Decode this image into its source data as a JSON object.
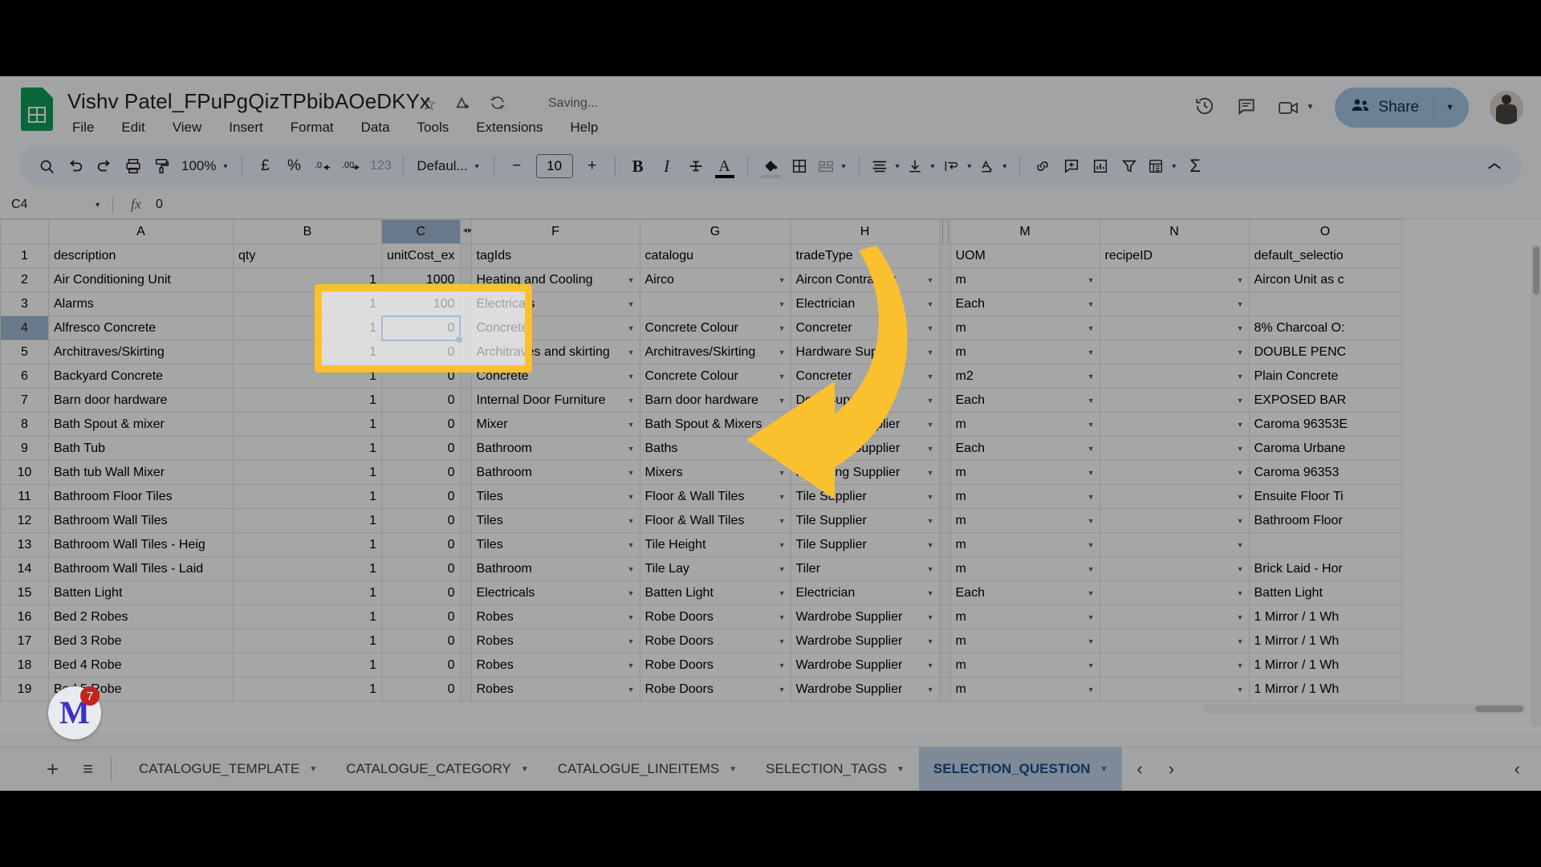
{
  "header": {
    "doc_title": "Vishv Patel_FPuPgQizTPbibAOeDKYx",
    "star_icon": "star-icon",
    "drive_icon": "move-to-drive-icon",
    "cloud_icon": "sync-icon",
    "save_status": "Saving...",
    "menus": [
      "File",
      "Edit",
      "View",
      "Insert",
      "Format",
      "Data",
      "Tools",
      "Extensions",
      "Help"
    ],
    "history_icon": "version-history-icon",
    "comment_icon": "comment-icon",
    "meet_icon": "meet-camera-icon",
    "share_label": "Share",
    "avatar": "user-avatar"
  },
  "toolbar": {
    "search": "🔍",
    "undo": "↺",
    "redo": "↻",
    "print": "print-icon",
    "paint": "paint-format-icon",
    "zoom": "100%",
    "currency": "£",
    "percent": "%",
    "dec_decrease": ".0",
    "dec_increase": ".00",
    "formats": "123",
    "font": "Defaul...",
    "font_size_minus": "−",
    "font_size": "10",
    "font_size_plus": "+",
    "bold": "B",
    "italic": "I",
    "strike": "S",
    "text_color": "A",
    "fill_color": "fill-color-icon",
    "borders": "borders-icon",
    "merge": "merge-cells-icon",
    "halign": "horizontal-align-icon",
    "valign": "vertical-align-icon",
    "wrap": "text-wrap-icon",
    "rotate": "text-rotation-icon",
    "link": "insert-link-icon",
    "comment_add": "insert-comment-icon",
    "chart": "insert-chart-icon",
    "filter": "filter-icon",
    "functions_calc": "pivot-icon",
    "sum": "Σ",
    "collapse": "collapse-toolbar-icon"
  },
  "formula_bar": {
    "cell_ref": "C4",
    "fx": "fx",
    "value": "0"
  },
  "grid": {
    "columns": [
      {
        "id": "A",
        "selected": false
      },
      {
        "id": "B",
        "selected": false
      },
      {
        "id": "C",
        "selected": true
      },
      {
        "id": "F",
        "selected": false
      },
      {
        "id": "G",
        "selected": false
      },
      {
        "id": "H",
        "selected": false
      },
      {
        "id": "M",
        "selected": false
      },
      {
        "id": "N",
        "selected": false
      },
      {
        "id": "O",
        "selected": false
      }
    ],
    "headers": [
      "description",
      "qty",
      "unitCost_ex",
      "tagIds",
      "catalogu",
      "tradeType",
      "UOM",
      "recipeID",
      "default_selectio"
    ],
    "selected_row": 4,
    "rows": [
      {
        "n": 1,
        "cells": [
          "description",
          "qty",
          "unitCost_ex",
          "tagIds",
          "catalogu",
          "tradeType",
          "UOM",
          "recipeID",
          "default_selectio"
        ],
        "is_header": true
      },
      {
        "n": 2,
        "cells": [
          "Air Conditioning Unit",
          "1",
          "1000",
          "Heating and Cooling",
          "Airco",
          "Aircon Contractor",
          "m",
          "",
          "Aircon Unit as c"
        ]
      },
      {
        "n": 3,
        "cells": [
          "Alarms",
          "1",
          "100",
          "Electricals",
          "",
          "Electrician",
          "Each",
          "",
          ""
        ]
      },
      {
        "n": 4,
        "cells": [
          "Alfresco Concrete",
          "1",
          "0",
          "Concrete",
          "Concrete Colour",
          "Concreter",
          "m",
          "",
          "8% Charcoal O:"
        ]
      },
      {
        "n": 5,
        "cells": [
          "Architraves/Skirting",
          "1",
          "0",
          "Architraves and skirting",
          "Architraves/Skirting",
          "Hardware Supplier",
          "m",
          "",
          "DOUBLE PENC"
        ]
      },
      {
        "n": 6,
        "cells": [
          "Backyard Concrete",
          "1",
          "0",
          "Concrete",
          "Concrete Colour",
          "Concreter",
          "m2",
          "",
          "Plain Concrete"
        ]
      },
      {
        "n": 7,
        "cells": [
          "Barn door hardware",
          "1",
          "0",
          "Internal Door Furniture",
          "Barn door hardware",
          "Door Supplier",
          "Each",
          "",
          "EXPOSED BAR"
        ]
      },
      {
        "n": 8,
        "cells": [
          "Bath Spout & mixer",
          "1",
          "0",
          "Mixer",
          "Bath Spout & Mixers",
          "Plumbing Supplier",
          "m",
          "",
          "Caroma 96353E"
        ]
      },
      {
        "n": 9,
        "cells": [
          "Bath Tub",
          "1",
          "0",
          "Bathroom",
          "Baths",
          "Plumbing Supplier",
          "Each",
          "",
          "Caroma Urbane"
        ]
      },
      {
        "n": 10,
        "cells": [
          "Bath tub Wall Mixer",
          "1",
          "0",
          "Bathroom",
          "Mixers",
          "Plumbing Supplier",
          "m",
          "",
          "Caroma 96353"
        ]
      },
      {
        "n": 11,
        "cells": [
          "Bathroom Floor Tiles",
          "1",
          "0",
          "Tiles",
          "Floor & Wall Tiles",
          "Tile Supplier",
          "m",
          "",
          "Ensuite Floor Ti"
        ]
      },
      {
        "n": 12,
        "cells": [
          "Bathroom Wall Tiles",
          "1",
          "0",
          "Tiles",
          "Floor & Wall Tiles",
          "Tile Supplier",
          "m",
          "",
          "Bathroom Floor"
        ]
      },
      {
        "n": 13,
        "cells": [
          "Bathroom Wall Tiles - Heig",
          "1",
          "0",
          "Tiles",
          "Tile Height",
          "Tile Supplier",
          "m",
          "",
          ""
        ]
      },
      {
        "n": 14,
        "cells": [
          "Bathroom Wall Tiles - Laid",
          "1",
          "0",
          "Bathroom",
          "Tile Lay",
          "Tiler",
          "m",
          "",
          "Brick Laid - Hor"
        ]
      },
      {
        "n": 15,
        "cells": [
          "Batten Light",
          "1",
          "0",
          "Electricals",
          "Batten Light",
          "Electrician",
          "Each",
          "",
          "Batten Light"
        ]
      },
      {
        "n": 16,
        "cells": [
          "Bed 2 Robes",
          "1",
          "0",
          "Robes",
          "Robe Doors",
          "Wardrobe Supplier",
          "m",
          "",
          "1 Mirror / 1 Wh"
        ]
      },
      {
        "n": 17,
        "cells": [
          "Bed 3 Robe",
          "1",
          "0",
          "Robes",
          "Robe Doors",
          "Wardrobe Supplier",
          "m",
          "",
          "1 Mirror / 1 Wh"
        ]
      },
      {
        "n": 18,
        "cells": [
          "Bed 4 Robe",
          "1",
          "0",
          "Robes",
          "Robe Doors",
          "Wardrobe Supplier",
          "m",
          "",
          "1 Mirror / 1 Wh"
        ]
      },
      {
        "n": 19,
        "cells": [
          "Bed 5 Robe",
          "1",
          "0",
          "Robes",
          "Robe Doors",
          "Wardrobe Supplier",
          "m",
          "",
          "1 Mirror / 1 Wh"
        ]
      }
    ],
    "dropdown_columns": [
      3,
      4,
      5,
      6,
      7
    ]
  },
  "annotation": {
    "highlight_color": "#fbc02d",
    "arrow_color": "#fbc02d",
    "target_cell": "C4"
  },
  "notification": {
    "app_glyph": "M",
    "count": "7"
  },
  "tabs": {
    "add_label": "+",
    "all_sheets_label": "≡",
    "sheets": [
      {
        "name": "CATALOGUE_TEMPLATE",
        "active": false
      },
      {
        "name": "CATALOGUE_CATEGORY",
        "active": false
      },
      {
        "name": "CATALOGUE_LINEITEMS",
        "active": false
      },
      {
        "name": "SELECTION_TAGS",
        "active": false
      },
      {
        "name": "SELECTION_QUESTION",
        "active": true
      }
    ],
    "prev_label": "‹",
    "next_label": "›",
    "side_panel_label": "‹"
  }
}
